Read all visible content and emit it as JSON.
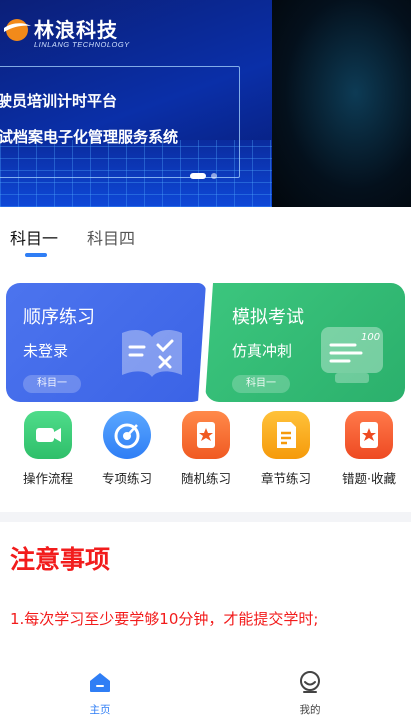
{
  "banner": {
    "brand_name": "林浪科技",
    "brand_sub": "LINLANG TECHNOLOGY",
    "line1": "驾驶员培训计时平台",
    "line2": "考试档案电子化管理服务系统",
    "colors": {
      "primary": "#0a2fa8",
      "accent": "#4fc3ff"
    }
  },
  "tabs": [
    {
      "label": "科目一",
      "active": true
    },
    {
      "label": "科目四",
      "active": false
    }
  ],
  "cards": [
    {
      "title": "顺序练习",
      "subtitle": "未登录",
      "chip": "科目一",
      "color": "#4c74ee",
      "icon": "book-check-icon"
    },
    {
      "title": "模拟考试",
      "subtitle": "仿真冲刺",
      "chip": "科目一",
      "color": "#3cc67e",
      "icon": "exam-score-icon"
    }
  ],
  "quick_actions": [
    {
      "label": "操作流程",
      "icon": "video-camera-icon",
      "color": "#2fbf6a"
    },
    {
      "label": "专项练习",
      "icon": "target-icon",
      "color": "#2f7ef5"
    },
    {
      "label": "随机练习",
      "icon": "random-card-icon",
      "color": "#f05a22"
    },
    {
      "label": "章节练习",
      "icon": "document-icon",
      "color": "#f59a0b"
    },
    {
      "label": "错题·收藏",
      "icon": "bookmark-card-icon",
      "color": "#ee4a22"
    }
  ],
  "notice": {
    "title": "注意事项",
    "items": [
      "1.每次学习至少要学够10分钟，才能提交学时;"
    ],
    "color": "#f21c1c"
  },
  "bottom_nav": [
    {
      "label": "主页",
      "icon": "home-icon",
      "active": true
    },
    {
      "label": "我的",
      "icon": "user-icon",
      "active": false
    }
  ]
}
